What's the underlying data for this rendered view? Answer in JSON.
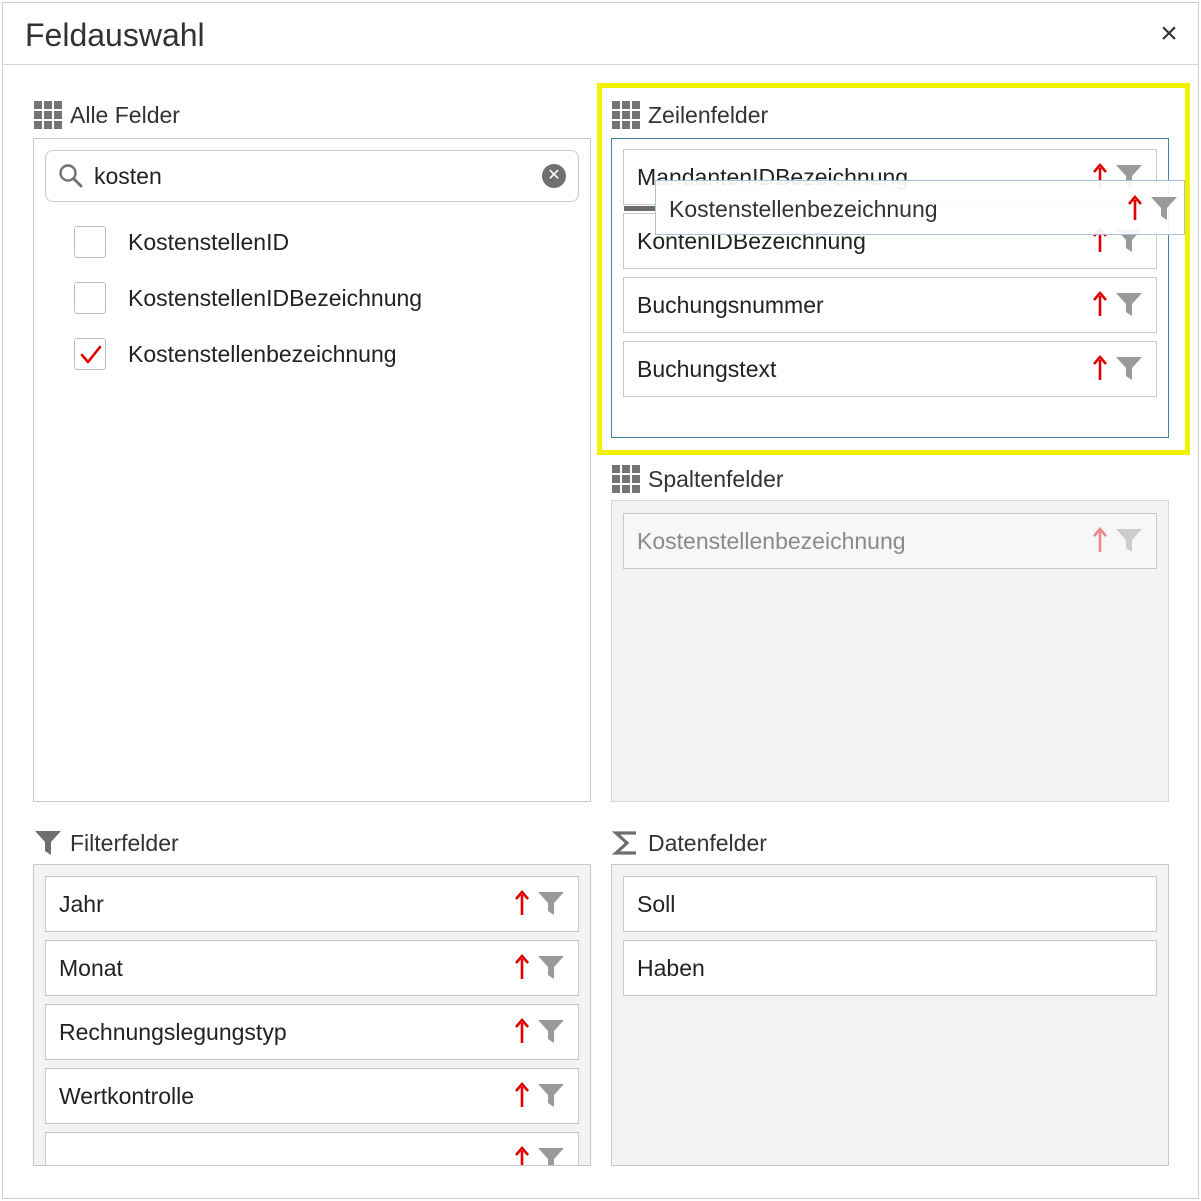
{
  "dialog": {
    "title": "Feldauswahl",
    "close_label": "×"
  },
  "all_fields": {
    "title": "Alle Felder",
    "search_value": "kosten",
    "items": [
      {
        "label": "KostenstellenID",
        "checked": false
      },
      {
        "label": "KostenstellenIDBezeichnung",
        "checked": false
      },
      {
        "label": "Kostenstellenbezeichnung",
        "checked": true
      }
    ]
  },
  "row_fields": {
    "title": "Zeilenfelder",
    "items": [
      "MandantenIDBezeichnung",
      "KontenIDBezeichnung",
      "Buchungsnummer",
      "Buchungstext"
    ],
    "dragging_item": "Kostenstellenbezeichnung"
  },
  "column_fields": {
    "title": "Spaltenfelder",
    "items": [
      "Kostenstellenbezeichnung"
    ]
  },
  "filter_fields": {
    "title": "Filterfelder",
    "items": [
      "Jahr",
      "Monat",
      "Rechnungslegungstyp",
      "Wertkontrolle"
    ]
  },
  "data_fields": {
    "title": "Datenfelder",
    "items": [
      "Soll",
      "Haben"
    ]
  },
  "colors": {
    "sort_arrow": "#e00000",
    "filter_funnel": "#9a9a9a",
    "drop_highlight": "#f2f200",
    "active_panel_border": "#4a7fa8",
    "check_mark": "#e00000"
  },
  "icons": {
    "grid": "grid-icon",
    "search": "search-icon",
    "clear": "clear-icon",
    "filter": "funnel-icon",
    "sort": "sort-ascending-icon",
    "sum": "sigma-icon",
    "close": "close-icon"
  }
}
